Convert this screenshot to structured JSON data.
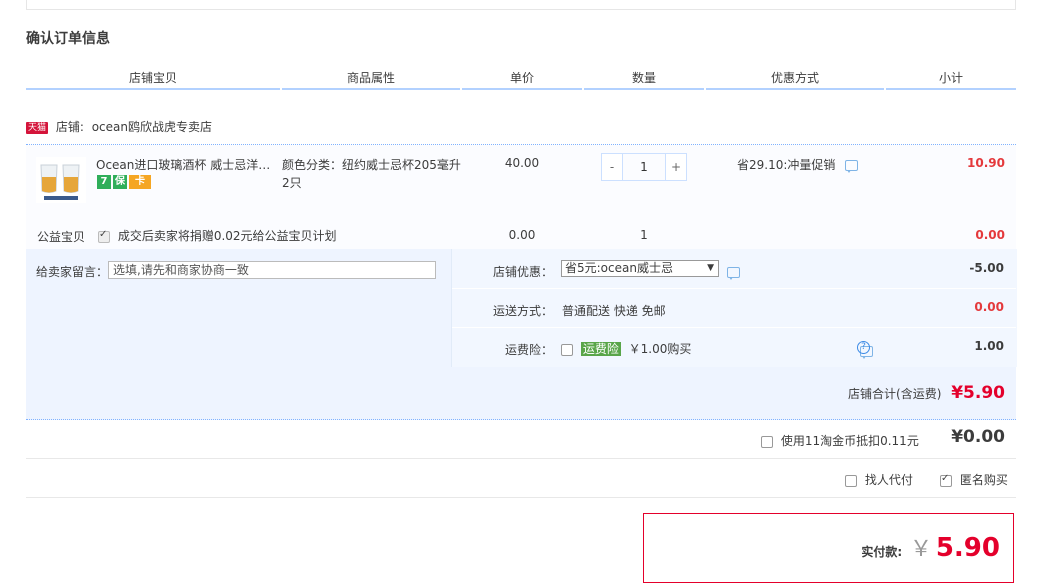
{
  "section_title": "确认订单信息",
  "headers": [
    "店铺宝贝",
    "商品属性",
    "单价",
    "数量",
    "优惠方式",
    "小计"
  ],
  "shop": {
    "badge": "天猫",
    "label": "店铺:",
    "name": "ocean鸥欣战虎专卖店"
  },
  "product": {
    "title": "Ocean进口玻璃酒杯 威士忌洋酒杯家用",
    "icons": [
      "seven-day-return-icon",
      "guarantee-icon",
      "credit-card-icon"
    ],
    "icon_glyphs": [
      "7",
      "保",
      "卡"
    ],
    "attr_line1": "颜色分类：纽约威士忌杯205毫升",
    "attr_line2": "2只",
    "price": "40.00",
    "qty_minus": "-",
    "qty": "1",
    "qty_plus": "+",
    "discount": "省29.10:冲量促销",
    "subtotal": "10.90"
  },
  "charity": {
    "label": "公益宝贝",
    "text": "成交后卖家将捐赠0.02元给公益宝贝计划",
    "price": "0.00",
    "qty": "1",
    "subtotal": "0.00"
  },
  "message": {
    "label": "给卖家留言：",
    "placeholder": "选填,请先和商家协商一致"
  },
  "shop_discount": {
    "label": "店铺优惠：",
    "selected": "省5元:ocean威士忌",
    "amount": "-5.00"
  },
  "shipping": {
    "label": "运送方式：",
    "value": "普通配送 快递 免邮",
    "amount": "0.00"
  },
  "insurance": {
    "label": "运费险：",
    "tag": "运费险",
    "price": "￥1.00购买",
    "amount": "1.00"
  },
  "shop_total": {
    "label": "店铺合计(含运费)",
    "value": "¥5.90"
  },
  "coins": {
    "label": "使用11淘金币抵扣0.11元",
    "value": "¥0.00"
  },
  "options": {
    "proxy_pay": "找人代付",
    "anonymous": "匿名购买"
  },
  "payment": {
    "label": "实付款:",
    "currency": "￥",
    "value": "5.90"
  },
  "colors": {
    "accent_red": "#e4002b",
    "header_blue": "#b2d1ff",
    "tmall_red": "#d4143a",
    "insurance_green": "#59a549"
  }
}
